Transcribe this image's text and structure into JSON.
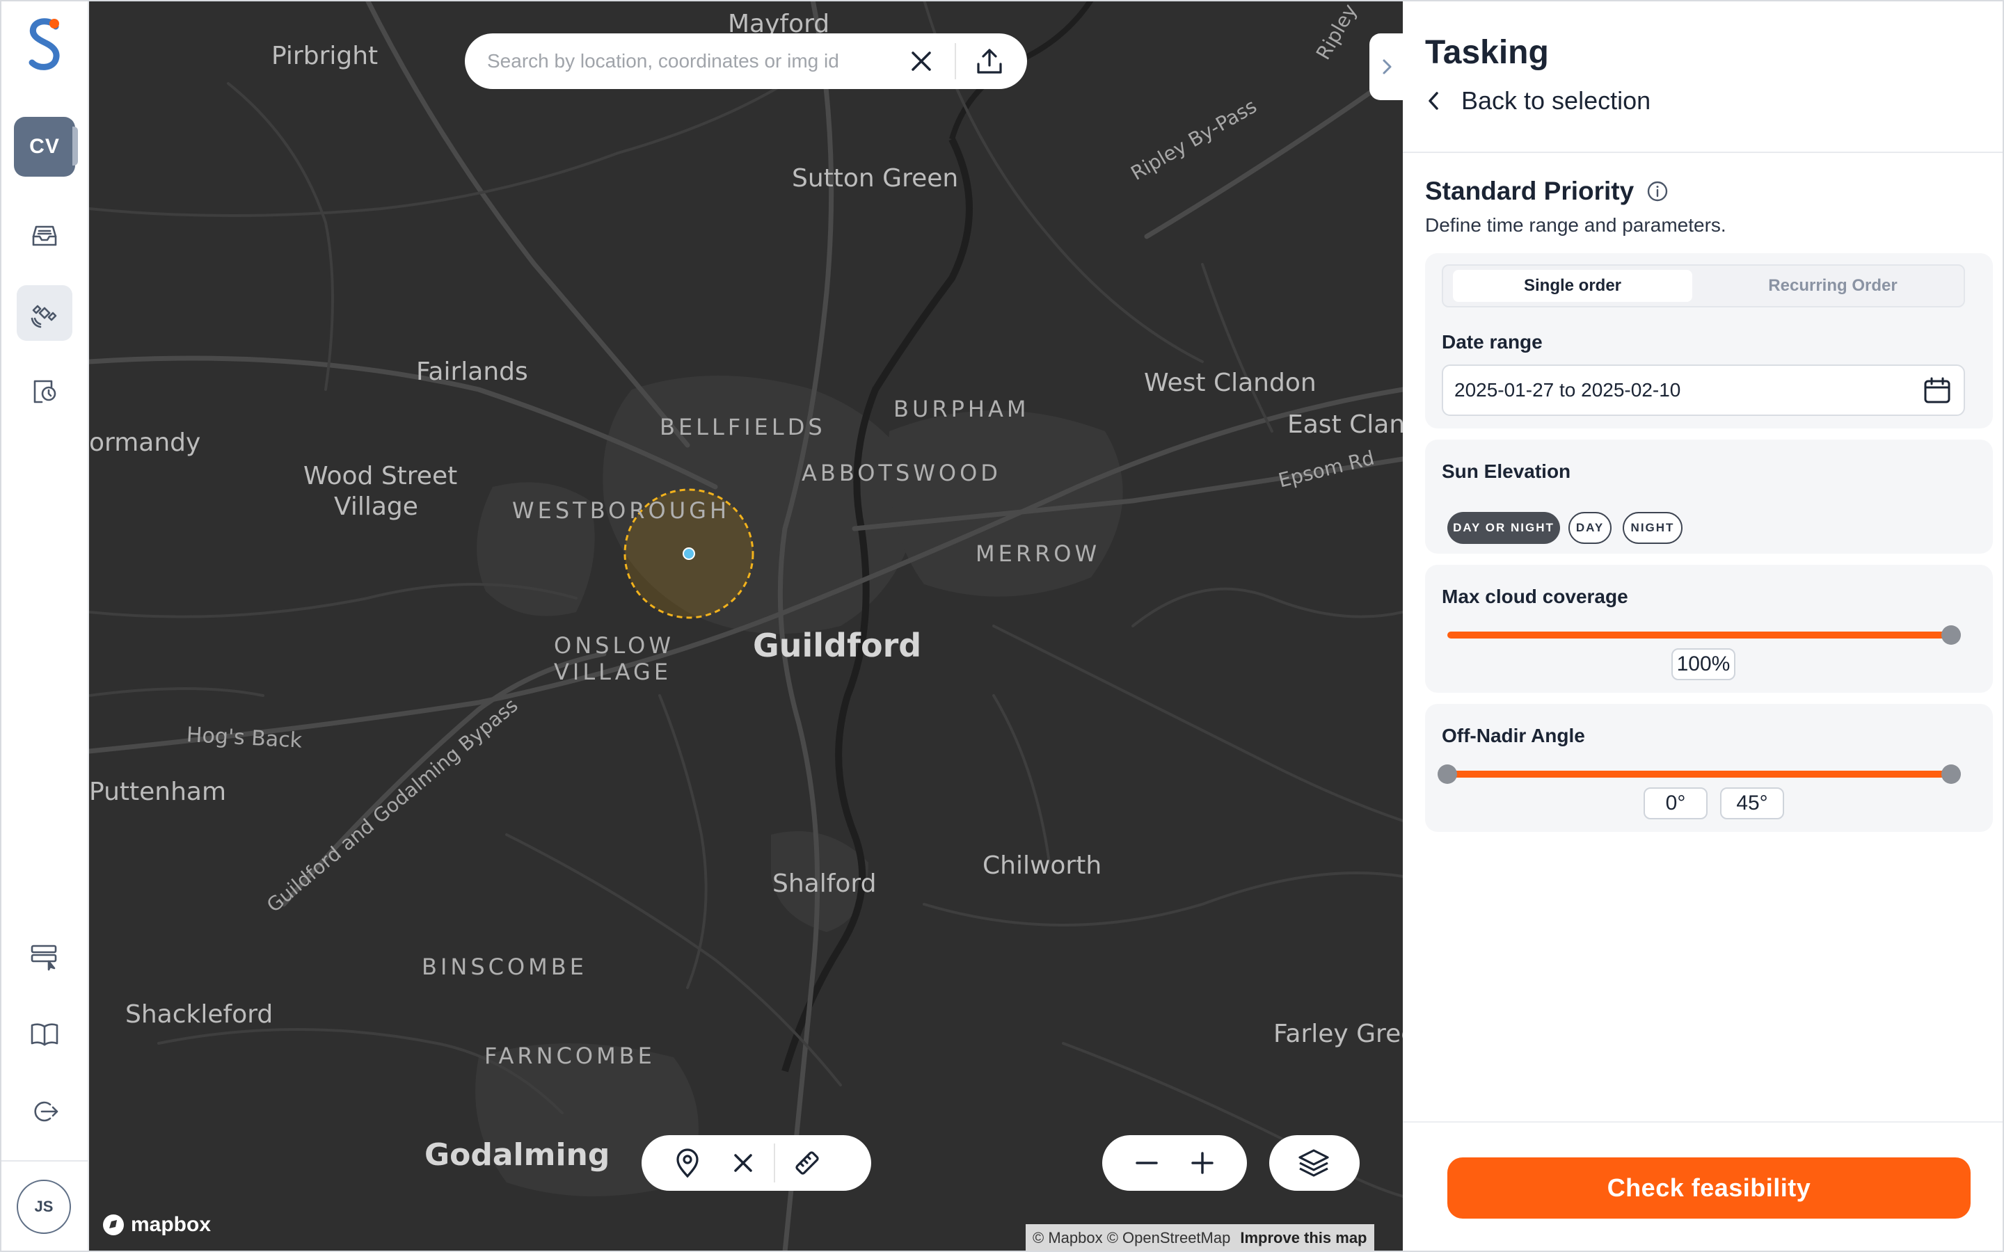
{
  "nav": {
    "logo_icon": "brand-s-logo",
    "workspace_initials": "CV",
    "items": [
      {
        "name": "orders-inbox-icon"
      },
      {
        "name": "satellite-icon"
      },
      {
        "name": "tasking-history-icon"
      },
      {
        "name": "data-catalog-icon"
      },
      {
        "name": "documentation-book-icon"
      },
      {
        "name": "logout-icon"
      }
    ],
    "user_initials": "JS"
  },
  "map": {
    "search_placeholder": "Search by location, coordinates or img id",
    "places": {
      "mayford": "Mayford",
      "pirbright": "Pirbright",
      "ripley": "Ripley",
      "sutton_green": "Sutton Green",
      "ripley_bypass": "Ripley By-Pass",
      "fairlands": "Fairlands",
      "west_clandon": "West Clandon",
      "east_clandon": "East Cland",
      "epsom_rd": "Epsom Rd",
      "bellfields": "BELLFIELDS",
      "burpham": "BURPHAM",
      "abbotswood": "ABBOTSWOOD",
      "normandy": "ormandy",
      "wood_street_1": "Wood Street",
      "wood_street_2": "Village",
      "westborough": "WESTBOROUGH",
      "merrow": "MERROW",
      "onslow_1": "ONSLOW",
      "onslow_2": "VILLAGE",
      "guildford": "Guildford",
      "hogs_back": "Hog's Back",
      "bypass": "Guildford and Godalming Bypass",
      "puttenham": "Puttenham",
      "shalford": "Shalford",
      "chilworth": "Chilworth",
      "binscombe": "BINSCOMBE",
      "shackleford": "Shackleford",
      "farley_green": "Farley Gree",
      "farncombe": "FARNCOMBE",
      "godalming": "Godalming"
    },
    "brand": "mapbox",
    "attribution": "© Mapbox © OpenStreetMap",
    "improve_link": "Improve this map"
  },
  "panel": {
    "title": "Tasking",
    "back_label": "Back to selection",
    "priority_title": "Standard Priority",
    "priority_sub": "Define time range and parameters.",
    "order_type": {
      "single": "Single order",
      "recurring": "Recurring Order",
      "selected": "Single order"
    },
    "date_range_label": "Date range",
    "date_range_value": "2025-01-27 to 2025-02-10",
    "sun_elevation_label": "Sun Elevation",
    "sun_options": [
      "DAY OR NIGHT",
      "DAY",
      "NIGHT"
    ],
    "sun_selected": "DAY OR NIGHT",
    "cloud_label": "Max cloud coverage",
    "cloud_value": "100%",
    "cloud_fraction": 1.0,
    "nadir_label": "Off-Nadir Angle",
    "nadir_min": "0°",
    "nadir_max": "45°",
    "cta_label": "Check feasibility"
  },
  "colors": {
    "accent": "#ff5f0f",
    "map_bg": "#2f2f2f",
    "aoi_stroke": "#f2b21c",
    "nav_selected": "#5f6f86"
  }
}
